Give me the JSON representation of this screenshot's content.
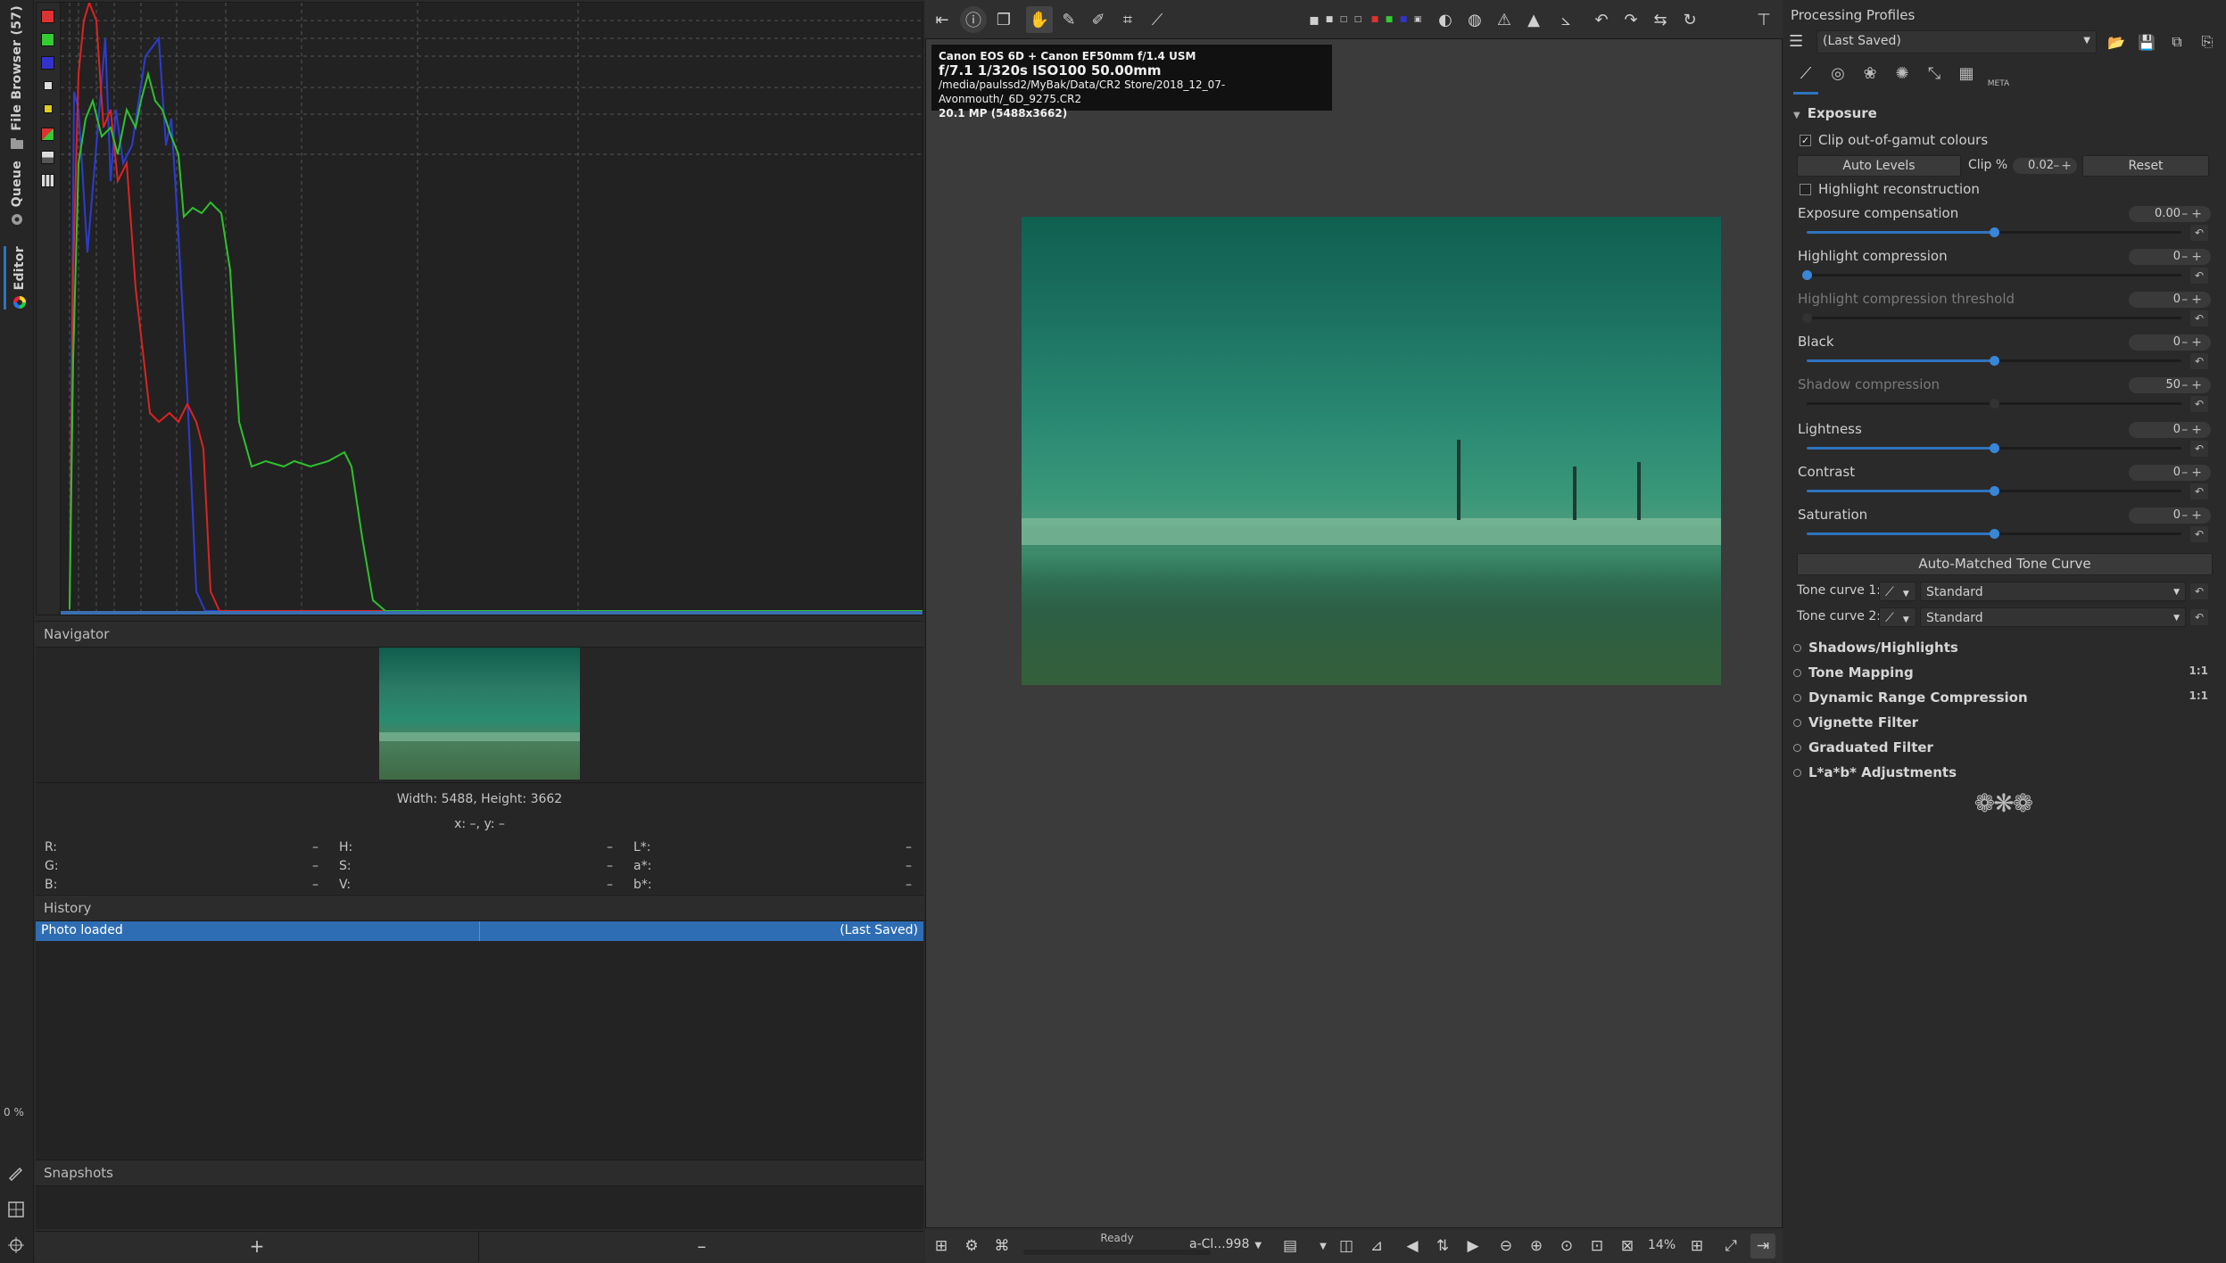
{
  "left_tabs": [
    {
      "label": "File Browser (57)",
      "icon": "folder-icon"
    },
    {
      "label": "Queue",
      "icon": "gear-icon"
    },
    {
      "label": "Editor",
      "icon": "color-wheel-icon"
    }
  ],
  "left_progress": "0 %",
  "histogram": {
    "channels": [
      "red",
      "green",
      "blue"
    ],
    "buttons": [
      "red-channel",
      "green-channel",
      "blue-channel",
      "luminance",
      "chroma",
      "raw",
      "bar",
      "mode"
    ]
  },
  "navigator": {
    "title": "Navigator",
    "dimensions": "Width: 5488, Height: 3662",
    "coords": "x: –, y: –",
    "cols": [
      {
        "rows": [
          {
            "k": "R:",
            "v": "–"
          },
          {
            "k": "G:",
            "v": "–"
          },
          {
            "k": "B:",
            "v": "–"
          }
        ]
      },
      {
        "rows": [
          {
            "k": "H:",
            "v": "–"
          },
          {
            "k": "S:",
            "v": "–"
          },
          {
            "k": "V:",
            "v": "–"
          }
        ]
      },
      {
        "rows": [
          {
            "k": "L*:",
            "v": "–"
          },
          {
            "k": "a*:",
            "v": "–"
          },
          {
            "k": "b*:",
            "v": "–"
          }
        ]
      }
    ]
  },
  "history": {
    "title": "History",
    "rows": [
      {
        "action": "Photo loaded",
        "note": "(Last Saved)"
      }
    ]
  },
  "snapshots": {
    "title": "Snapshots",
    "add_label": "+",
    "remove_label": "–"
  },
  "photo_info": {
    "camera": "Canon EOS 6D + Canon EF50mm f/1.4 USM",
    "exposure": "f/7.1  1/320s  ISO100  50.00mm",
    "path": "/media/paulssd2/MyBak/Data/CR2 Store/2018_12_07-Avonmouth/_6D_9275.CR2",
    "size": "20.1 MP (5488x3662)"
  },
  "status": {
    "ready": "Ready",
    "profile": "a-Cl...998",
    "zoom": "14%"
  },
  "right": {
    "profiles_title": "Processing Profiles",
    "profile_value": "(Last Saved)",
    "exposure_title": "Exposure",
    "clip_gamut": "Clip out-of-gamut colours",
    "auto_levels": "Auto Levels",
    "clip_label": "Clip %",
    "clip_value": "0.02",
    "reset_label": "Reset",
    "highlight_recon": "Highlight reconstruction",
    "sliders": [
      {
        "label": "Exposure compensation",
        "value": "0.00",
        "level": 0.5,
        "enabled": true
      },
      {
        "label": "Highlight compression",
        "value": "0",
        "level": 0.0,
        "enabled": true
      },
      {
        "label": "Highlight compression threshold",
        "value": "0",
        "level": 0.0,
        "enabled": false
      },
      {
        "label": "Black",
        "value": "0",
        "level": 0.5,
        "enabled": true
      },
      {
        "label": "Shadow compression",
        "value": "50",
        "level": 0.5,
        "enabled": false
      },
      {
        "label": "Lightness",
        "value": "0",
        "level": 0.5,
        "enabled": true
      },
      {
        "label": "Contrast",
        "value": "0",
        "level": 0.5,
        "enabled": true
      },
      {
        "label": "Saturation",
        "value": "0",
        "level": 0.5,
        "enabled": true
      }
    ],
    "auto_matched": "Auto-Matched Tone Curve",
    "tone_curves": [
      {
        "label": "Tone curve 1:",
        "value": "Standard"
      },
      {
        "label": "Tone curve 2:",
        "value": "Standard"
      }
    ],
    "sections": [
      {
        "label": "Shadows/Highlights",
        "ratio": ""
      },
      {
        "label": "Tone Mapping",
        "ratio": "1:1"
      },
      {
        "label": "Dynamic Range Compression",
        "ratio": "1:1"
      },
      {
        "label": "Vignette Filter",
        "ratio": ""
      },
      {
        "label": "Graduated Filter",
        "ratio": ""
      },
      {
        "label": "L*a*b* Adjustments",
        "ratio": ""
      }
    ],
    "tool_tabs": [
      "exposure-tab-icon",
      "detail-tab-icon",
      "color-tab-icon",
      "advanced-tab-icon",
      "transform-tab-icon",
      "raw-tab-icon",
      "metadata-tab-icon"
    ],
    "meta_label": "META"
  }
}
